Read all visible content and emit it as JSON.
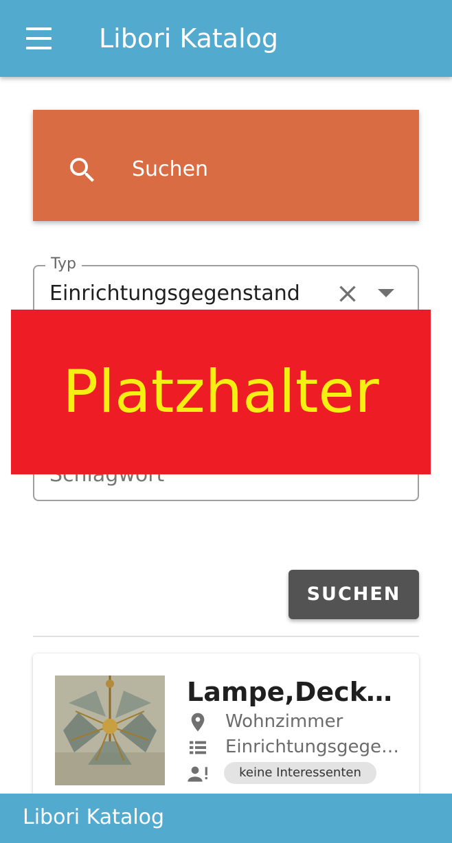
{
  "appbar": {
    "title": "Libori Katalog",
    "menu_icon": "hamburger-menu-icon"
  },
  "search_panel": {
    "icon": "search-icon",
    "label": "Suchen"
  },
  "form": {
    "typ": {
      "label": "Typ",
      "value": "Einrichtungsgegenstand",
      "clear_icon": "close-icon",
      "dropdown_icon": "arrow-drop-down-icon"
    },
    "schlagwort": {
      "placeholder": "Schlagwort"
    },
    "placeholder_banner": {
      "text": "Platzhalter",
      "background": "#ee1c25",
      "color": "#f5ef12"
    },
    "submit_label": "SUCHEN"
  },
  "results": [
    {
      "title": "Lampe,Decken…",
      "location": "Wohnzimmer",
      "type": "Einrichtungsgegen…",
      "interest_badge": "keine Interessenten",
      "icons": [
        "location-pin-icon",
        "list-icon",
        "person-alert-icon"
      ]
    }
  ],
  "footer": {
    "title": "Libori Katalog"
  },
  "colors": {
    "primary": "#52abcf",
    "search_panel": "#d96c43",
    "button": "#535353"
  }
}
